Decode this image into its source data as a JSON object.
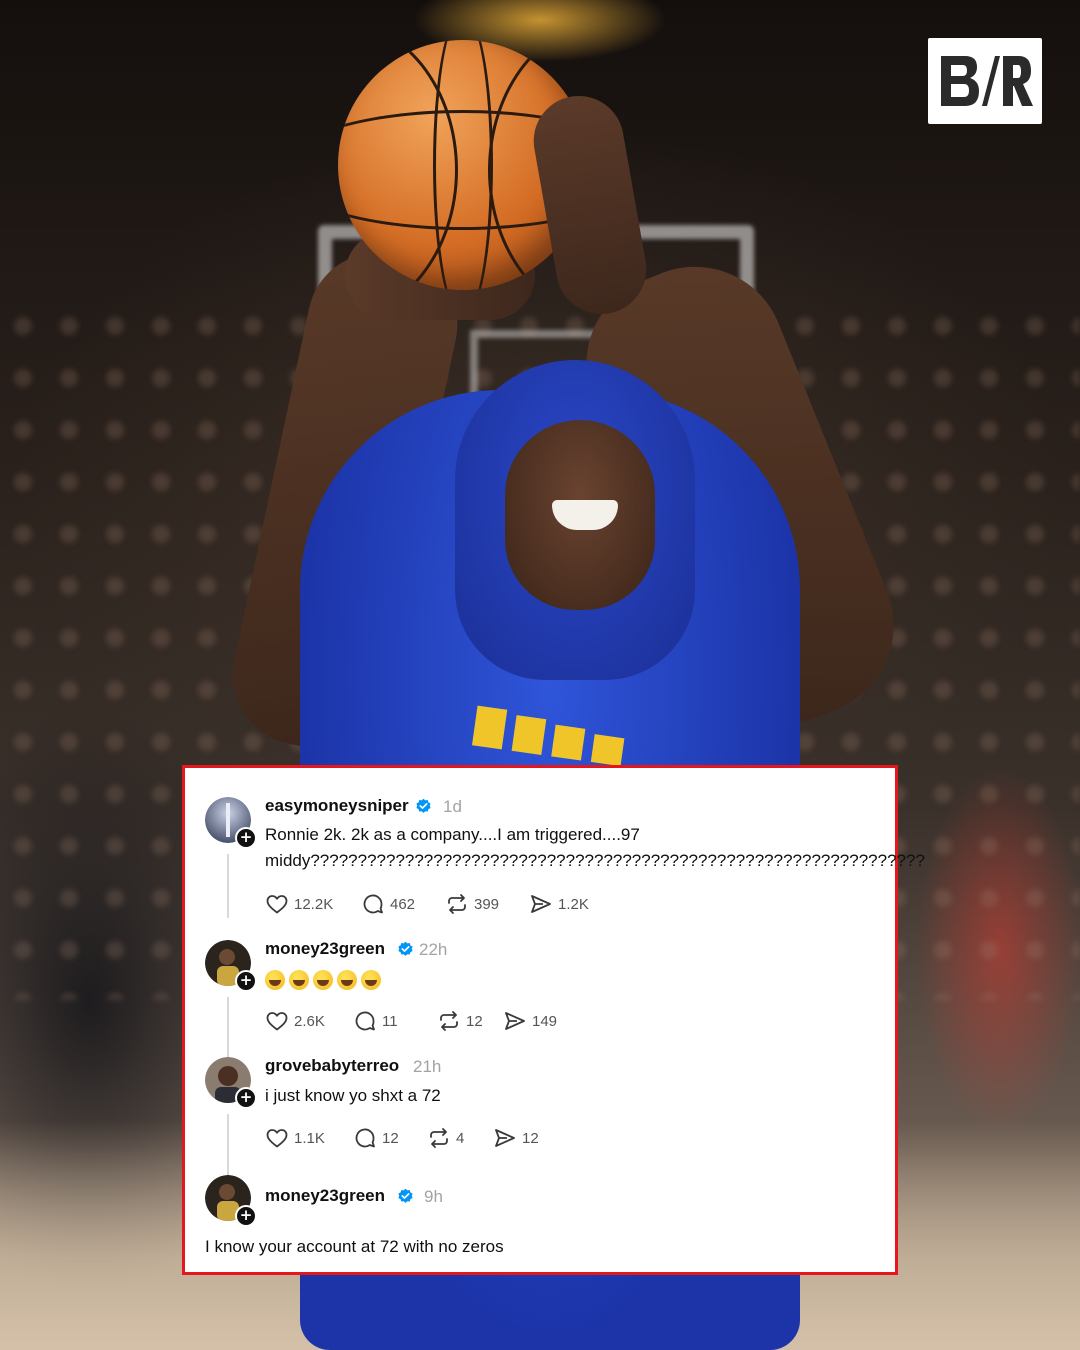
{
  "brand": {
    "logo_text": "B/R"
  },
  "posts": [
    {
      "username": "easymoneysniper",
      "time": "1d",
      "text_line1": "Ronnie 2k. 2k as a company....I am triggered....97",
      "text_line2": "middy?????????????????????????????????????????????????????????????????",
      "likes": "12.2K",
      "replies": "462",
      "reposts": "399",
      "shares": "1.2K"
    },
    {
      "username": "money23green",
      "time": "22h",
      "emoji_count": 5,
      "emoji_name": "rolling-on-floor-laughing",
      "likes": "2.6K",
      "replies": "11",
      "reposts": "12",
      "shares": "149"
    },
    {
      "username": "grovebabyterreo",
      "time": "21h",
      "text": "i just know yo shxt a 72",
      "likes": "1.1K",
      "replies": "12",
      "reposts": "4",
      "shares": "12"
    },
    {
      "username": "money23green",
      "time": "9h",
      "text": "I know your account at 72 with no zeros"
    }
  ],
  "colors": {
    "card_border": "#e5161c",
    "verified": "#0095f6",
    "username": "#101010",
    "timestamp": "#a3a3a3"
  },
  "icons": [
    "heart-icon",
    "reply-icon",
    "repost-icon",
    "share-icon",
    "verified-badge-icon",
    "follow-plus-icon"
  ]
}
